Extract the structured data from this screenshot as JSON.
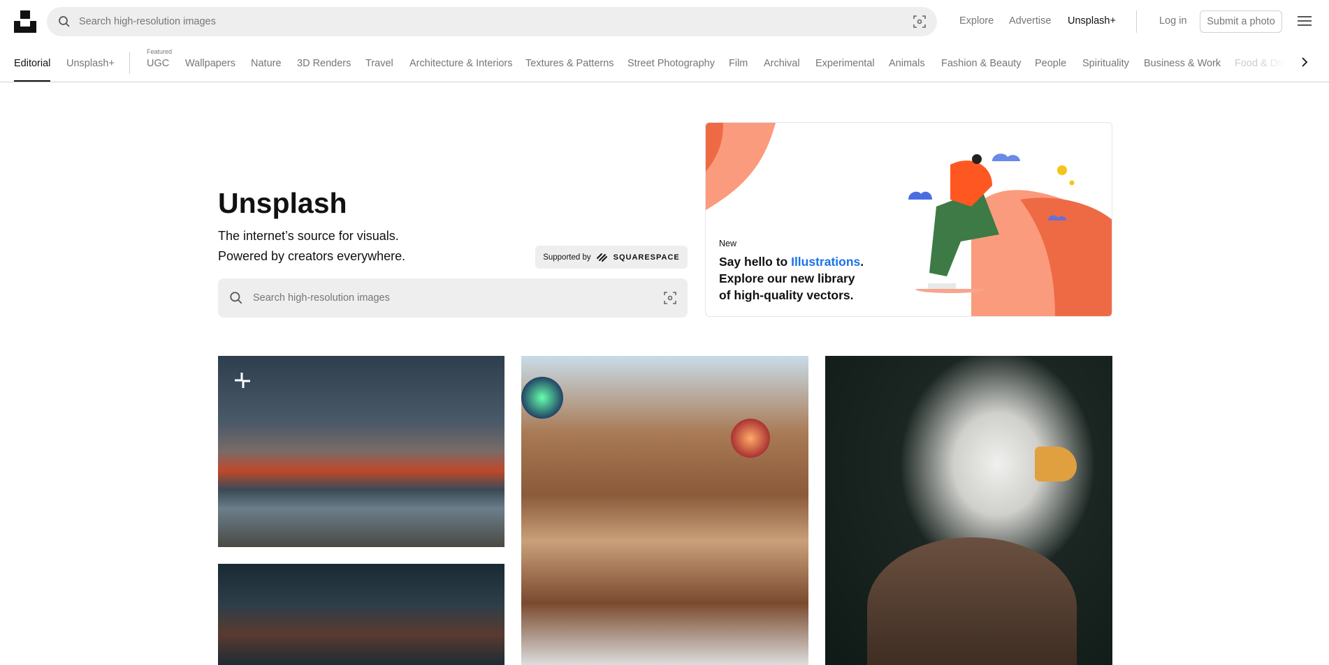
{
  "header": {
    "search_placeholder": "Search high-resolution images",
    "links": [
      "Explore",
      "Advertise",
      "Unsplash+"
    ],
    "login": "Log in",
    "submit": "Submit a photo"
  },
  "categories": {
    "pinned": [
      "Editorial",
      "Unsplash+"
    ],
    "featured_label": "Featured",
    "items": [
      "UGC",
      "Wallpapers",
      "Nature",
      "3D Renders",
      "Travel",
      "Architecture & Interiors",
      "Textures & Patterns",
      "Street Photography",
      "Film",
      "Archival",
      "Experimental",
      "Animals",
      "Fashion & Beauty",
      "People",
      "Spirituality",
      "Business & Work",
      "Food & Drink"
    ],
    "active": "Editorial"
  },
  "hero": {
    "title": "Unsplash",
    "line1": "The internet’s source for visuals.",
    "line2": "Powered by creators everywhere.",
    "supported_by": "Supported by",
    "sponsor": "SQUARESPACE",
    "search_placeholder": "Search high-resolution images"
  },
  "banner": {
    "tag": "New",
    "line1_a": "Say hello to ",
    "line1_link": "Illustrations",
    "line1_b": ".",
    "line2": "Explore our new library",
    "line3": "of high-quality vectors.",
    "link_color": "#1a73e8"
  },
  "photos": [
    "mountain-lake-landscape",
    "library-interior-with-globes",
    "bald-eagle-portrait",
    "building-facade-with-trees"
  ]
}
